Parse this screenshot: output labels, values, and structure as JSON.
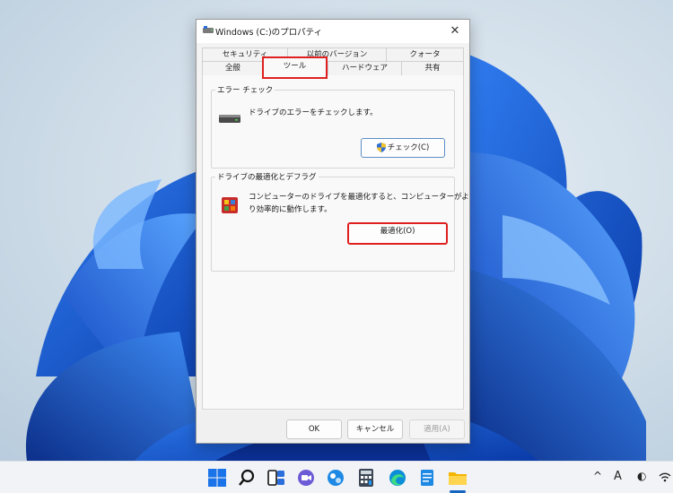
{
  "window": {
    "title": "Windows (C:)のプロパティ",
    "close_glyph": "✕"
  },
  "tabs": {
    "row1": [
      "セキュリティ",
      "以前のバージョン",
      "クォータ"
    ],
    "row2": [
      "全般",
      "ツール",
      "ハードウェア",
      "共有"
    ],
    "selected": "ツール"
  },
  "error_check": {
    "title": "エラー チェック",
    "description": "ドライブのエラーをチェックします。",
    "button_label": "チェック(C)",
    "icon": "drive-icon",
    "button_icon": "shield-icon"
  },
  "optimize": {
    "title": "ドライブの最適化とデフラグ",
    "description_line1": "コンピューターのドライブを最適化すると、コンピューターがよ",
    "description_line2": "り効率的に動作します。",
    "button_label": "最適化(O)",
    "icon": "defrag-icon"
  },
  "footer": {
    "ok": "OK",
    "cancel": "キャンセル",
    "apply": "適用(A)",
    "apply_enabled": false
  },
  "taskbar": {
    "icons": [
      "start-icon",
      "search-icon",
      "task-view-icon",
      "chat-icon",
      "snipping-tool-icon",
      "calculator-icon",
      "edge-icon",
      "notepad-icon",
      "file-explorer-icon"
    ],
    "tray": {
      "chevron": "^",
      "ime": "A",
      "ime_mode": "◐"
    }
  },
  "colors": {
    "highlight": "#e02020",
    "accent": "#1565c0"
  }
}
